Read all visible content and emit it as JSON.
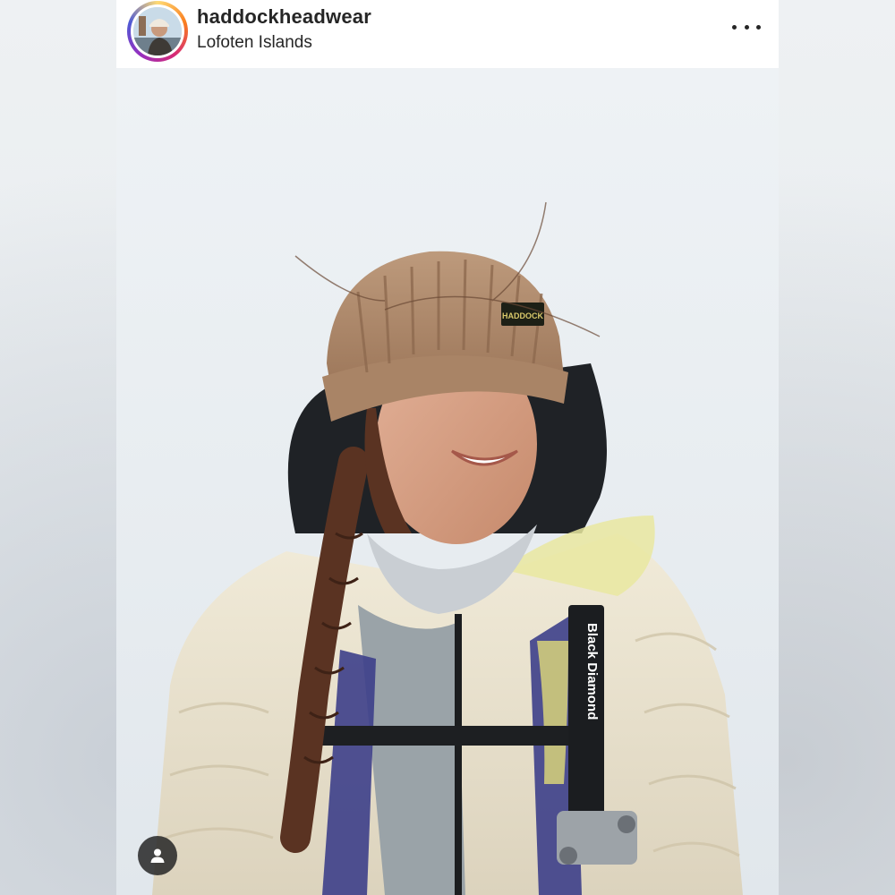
{
  "post": {
    "username": "haddockheadwear",
    "location": "Lofoten Islands",
    "more_icon": "more-horizontal-icon",
    "tag_icon": "user-tag-icon"
  },
  "photo": {
    "beanie_label": "HADDOCK",
    "strap_text": "Black Diamond"
  },
  "colors": {
    "text": "#262626",
    "ring_start": "#feda75",
    "ring_end": "#962fbf",
    "sky": "#eef2f5",
    "beanie": "#b08a6c",
    "jacket": "#ede6d3",
    "hood": "#1f2226",
    "hair": "#5a3322"
  }
}
